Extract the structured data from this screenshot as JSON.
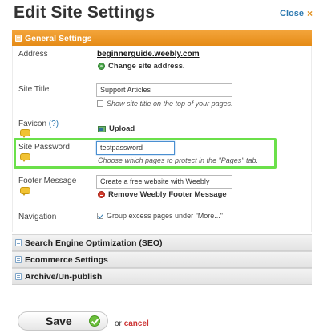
{
  "header": {
    "title": "Edit Site Settings",
    "close_label": "Close",
    "close_icon": "×"
  },
  "general_settings": {
    "section_title": "General Settings",
    "address": {
      "label": "Address",
      "value": "beginnerguide.weebly.com",
      "change_label": "Change site address."
    },
    "site_title": {
      "label": "Site Title",
      "value": "Support Articles",
      "checkbox_label": "Show site title on the top of your pages.",
      "checked": false
    },
    "favicon": {
      "label": "Favicon",
      "help_link": "(?)",
      "upload_label": "Upload"
    },
    "site_password": {
      "label": "Site Password",
      "value": "testpassword",
      "hint": "Choose which pages to protect in the \"Pages\" tab."
    },
    "footer_message": {
      "label": "Footer Message",
      "value": "Create a free website with Weebly",
      "remove_label": "Remove Weebly Footer Message"
    },
    "navigation": {
      "label": "Navigation",
      "checkbox_label": "Group excess pages under \"More...\"",
      "checked": true
    }
  },
  "collapsed_sections": [
    {
      "title": "Search Engine Optimization (SEO)"
    },
    {
      "title": "Ecommerce Settings"
    },
    {
      "title": "Archive/Un-publish"
    }
  ],
  "footer": {
    "save_label": "Save",
    "or_text": "or",
    "cancel_label": "cancel"
  },
  "colors": {
    "accent_orange": "#e58b16",
    "highlight_green": "#6be04a",
    "link_blue": "#2d79b0",
    "cancel_red": "#cc3333"
  }
}
